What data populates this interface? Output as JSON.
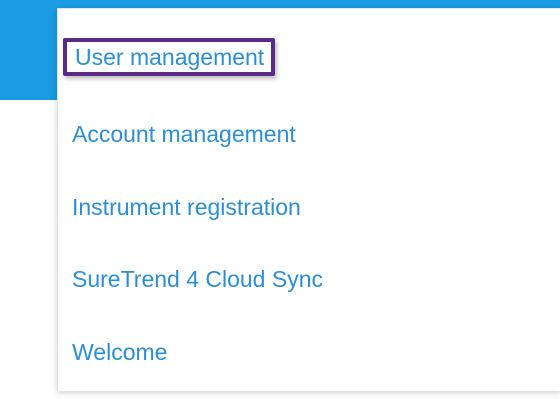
{
  "menu": {
    "items": [
      {
        "label": "User management",
        "selected": true
      },
      {
        "label": "Account management",
        "selected": false
      },
      {
        "label": "Instrument registration",
        "selected": false
      },
      {
        "label": "SureTrend 4 Cloud Sync",
        "selected": false
      },
      {
        "label": "Welcome",
        "selected": false
      }
    ]
  },
  "colors": {
    "header_blue": "#1a9be3",
    "link_blue": "#2a8fd6",
    "selection_border": "#5b2a86"
  }
}
